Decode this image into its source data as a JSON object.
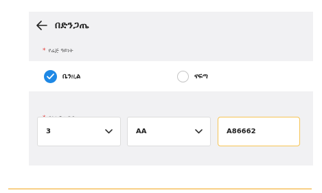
{
  "header": {
    "title": "በድንጋጤ"
  },
  "vehicle_type": {
    "label": "የሬጅ ዓይነት",
    "options": [
      {
        "label": "ቤንዚል",
        "checked": true
      },
      {
        "label": "ናፍጣ",
        "checked": false
      }
    ]
  },
  "plate": {
    "label": "የሰሌዳ ቁጥር",
    "region_value": "3",
    "code_value": "AA",
    "number_value": "A86662"
  },
  "colors": {
    "accent": "#1e88e5",
    "focus": "#f6c453",
    "required": "#e53935"
  }
}
